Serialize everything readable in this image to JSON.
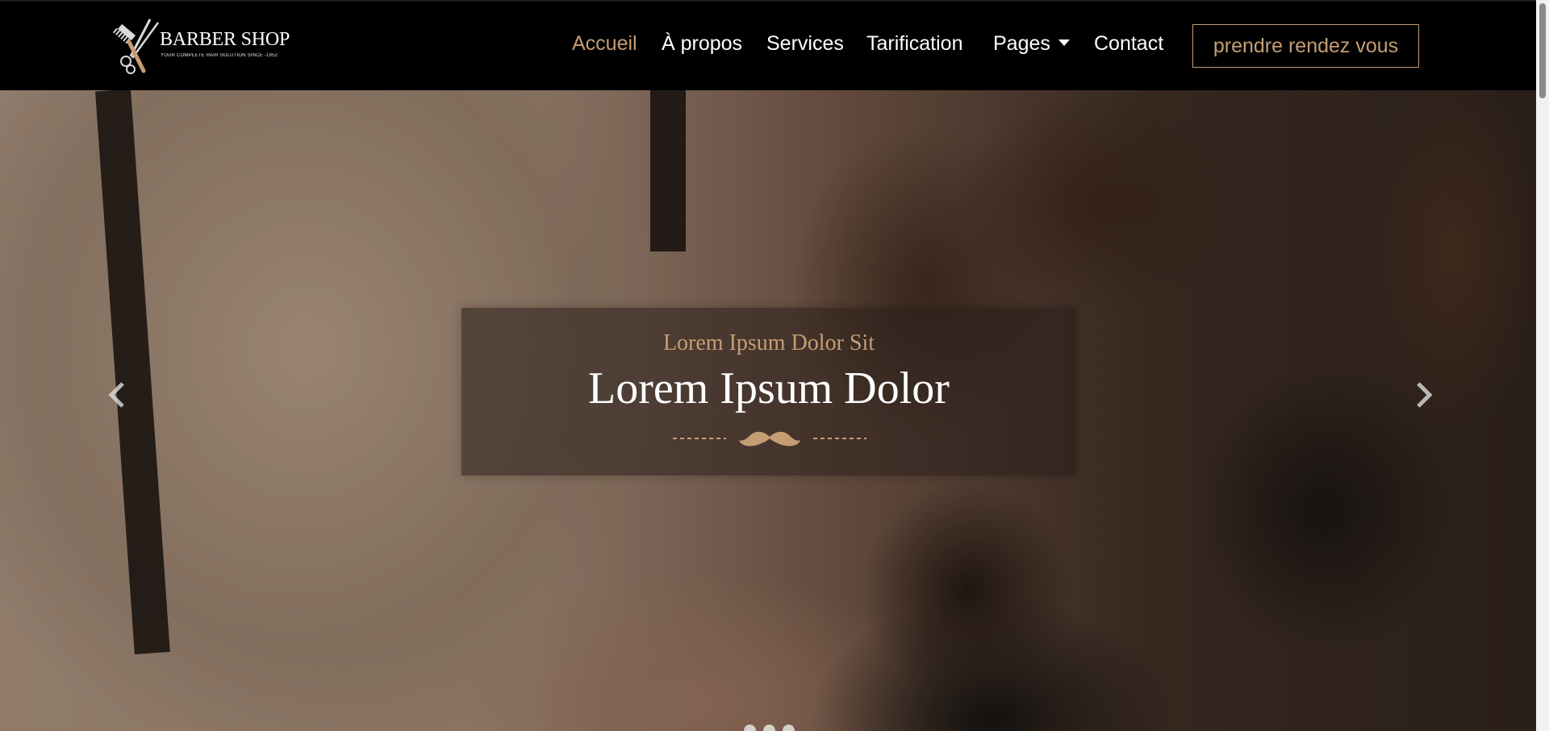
{
  "brand": {
    "name": "BARBER SHOP",
    "tagline": "YOUR COMPLETE HAIR SOLUTION SINCE -1952",
    "accent_color": "#c59d74"
  },
  "nav": {
    "items": [
      {
        "label": "Accueil",
        "active": true
      },
      {
        "label": "À propos"
      },
      {
        "label": "Services"
      },
      {
        "label": "Tarification"
      },
      {
        "label": "Pages",
        "dropdown": true
      },
      {
        "label": "Contact"
      }
    ],
    "cta_label": "prendre rendez vous"
  },
  "hero": {
    "subtitle": "Lorem Ipsum Dolor Sit",
    "title": "Lorem Ipsum Dolor",
    "ornament_icon": "mustache-icon",
    "prev_icon": "chevron-left-icon",
    "next_icon": "chevron-right-icon",
    "slide_count": 3,
    "active_slide": 1
  }
}
